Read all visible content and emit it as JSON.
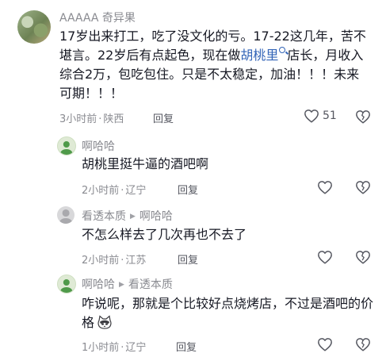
{
  "comments": [
    {
      "username": "AAAAA 奇异果",
      "text_before_link": "17岁出来打工，吃了没文化的亏。17-22这几年，苦不堪言。22岁后有点起色，现在做",
      "link_text": "胡桃里",
      "text_after_link": "店长，月收入综合2万，包吃包住。只是不太稳定，加油！！！未来可期！！！",
      "time": "3小时前",
      "location": "陕西",
      "reply_label": "回复",
      "like_count": "51"
    },
    {
      "username": "啊哈哈",
      "text": "胡桃里挺牛逼的酒吧啊",
      "time": "2小时前",
      "location": "辽宁",
      "reply_label": "回复"
    },
    {
      "username": "看透本质",
      "reply_to": "啊哈哈",
      "text": "不怎么样去了几次再也不去了",
      "time": "2小时前",
      "location": "江苏",
      "reply_label": "回复"
    },
    {
      "username": "啊哈哈",
      "reply_to": "看透本质",
      "text": "咋说呢，那就是个比较好点烧烤店，不过是酒吧的价格",
      "time": "1小时前",
      "location": "辽宁",
      "reply_label": "回复"
    }
  ],
  "meta_separator": "·",
  "icons": {
    "like": "heart-outline-icon",
    "dislike": "broken-heart-outline-icon",
    "search": "search-icon",
    "reply_arrow": "triangle-right-icon",
    "emoji": "cat-emoji-icon"
  },
  "colors": {
    "text": "#161823",
    "secondary": "#8a8b91",
    "link": "#3264b7"
  }
}
